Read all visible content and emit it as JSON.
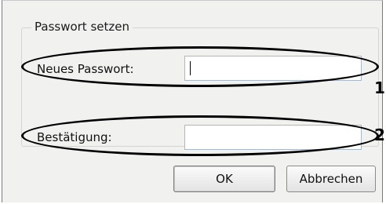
{
  "dialog": {
    "group_title": "Passwort setzen",
    "new_password": {
      "label": "Neues Passwort:",
      "value": "",
      "marker": "1"
    },
    "confirmation": {
      "label": "Bestätigung:",
      "value": "",
      "marker": "2"
    },
    "buttons": {
      "ok": "OK",
      "cancel": "Abbrechen"
    }
  },
  "colors": {
    "dialog_background": "#f1f1ef",
    "input_border": "#a9b7c6",
    "annotation": "#000000"
  }
}
